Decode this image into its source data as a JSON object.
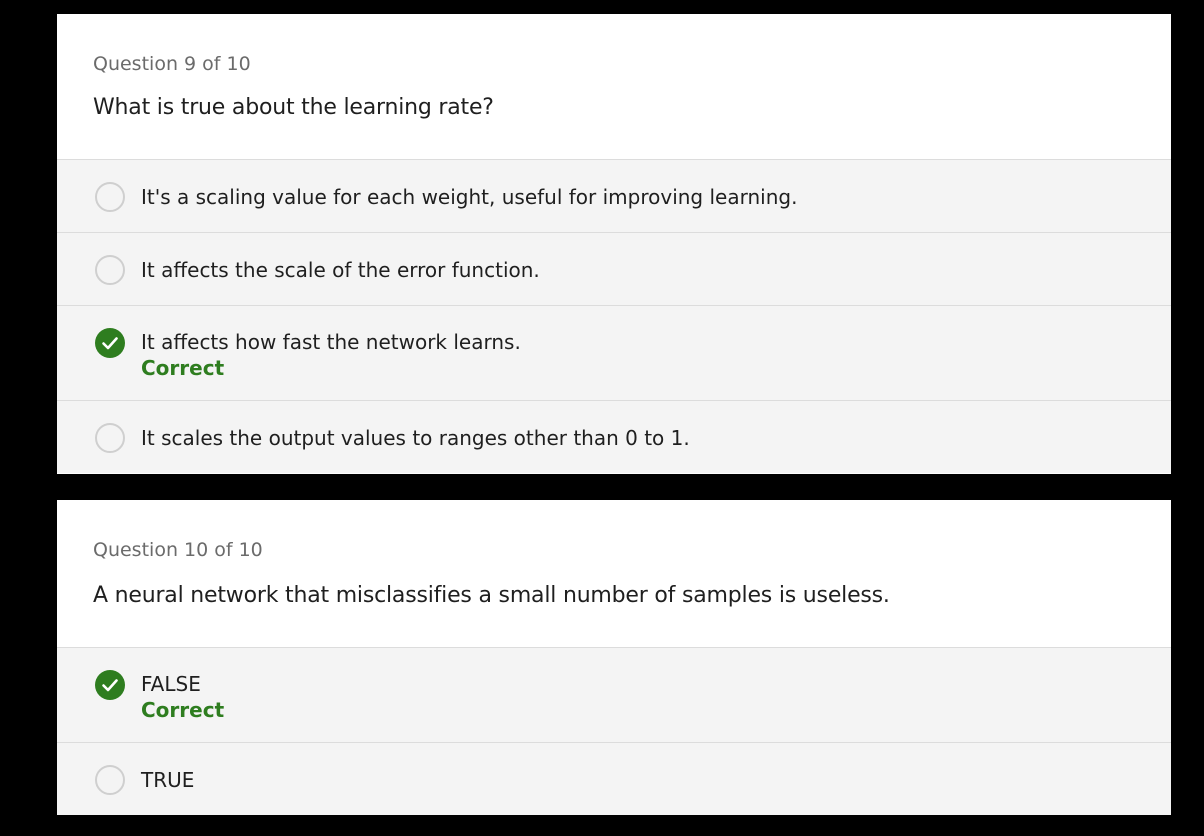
{
  "questions": [
    {
      "counter": "Question 9 of 10",
      "text": "What is true about the learning rate?",
      "options": [
        {
          "label": "It's a scaling value for each weight, useful for improving learning.",
          "selected": false,
          "feedback": ""
        },
        {
          "label": "It affects the scale of the error function.",
          "selected": false,
          "feedback": ""
        },
        {
          "label": "It affects how fast the network learns.",
          "selected": true,
          "feedback": "Correct"
        },
        {
          "label": "It scales the output values to ranges other than 0 to 1.",
          "selected": false,
          "feedback": ""
        }
      ]
    },
    {
      "counter": "Question 10 of 10",
      "text": "A neural network that misclassifies a small number of samples is useless.",
      "options": [
        {
          "label": "FALSE",
          "selected": true,
          "feedback": "Correct"
        },
        {
          "label": "TRUE",
          "selected": false,
          "feedback": ""
        }
      ]
    }
  ],
  "colors": {
    "background": "#000000",
    "card": "#ffffff",
    "option_bg": "#f4f4f4",
    "correct_green": "#2e7d1f",
    "radio_border": "#cfcfcf"
  },
  "icons": {
    "selected": "checkmark-circle-icon",
    "unselected": "radio-circle-icon"
  }
}
